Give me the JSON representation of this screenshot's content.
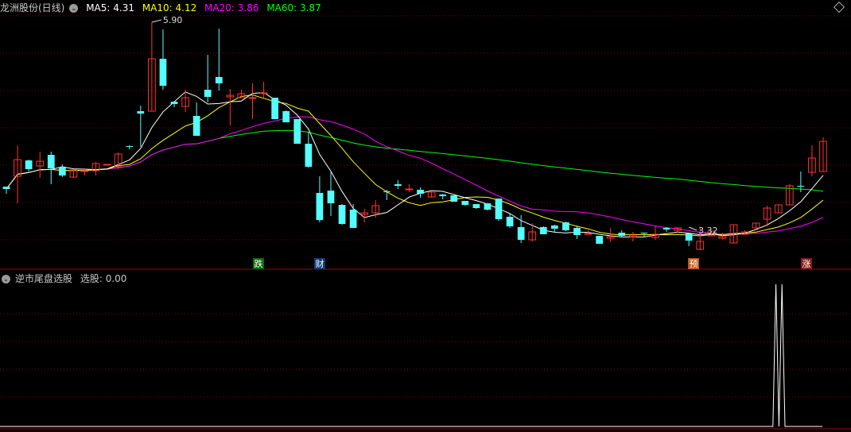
{
  "top_legend": {
    "stock_name": "龙洲股份(日线)",
    "ma5": "MA5: 4.31",
    "ma10": "MA10: 4.12",
    "ma20": "MA20: 3.86",
    "ma60": "MA60: 3.87"
  },
  "bottom_legend": {
    "indicator": "逆市尾盘选股",
    "value": "选股: 0.00"
  },
  "colors": {
    "up": "#ff3232",
    "down": "#54ffff",
    "ma5": "#ffffff",
    "ma10": "#ffff00",
    "ma20": "#ff00ff",
    "ma60": "#00ff00",
    "grid": "#8b0000",
    "signal": "#ffffff"
  },
  "chart_data": [
    {
      "type": "candlestick",
      "ohlc": [
        [
          3.83,
          3.83,
          3.74,
          3.8
        ],
        [
          3.96,
          4.35,
          3.62,
          4.17
        ],
        [
          4.16,
          4.17,
          4.02,
          4.05
        ],
        [
          4.09,
          4.27,
          3.94,
          4.15
        ],
        [
          4.23,
          4.27,
          3.86,
          4.06
        ],
        [
          4.07,
          4.11,
          3.95,
          3.97
        ],
        [
          3.95,
          4.05,
          3.94,
          4.04
        ],
        [
          4.02,
          4.05,
          3.97,
          4.03
        ],
        [
          4.03,
          4.14,
          3.97,
          4.12
        ],
        [
          4.11,
          4.11,
          4.11,
          4.11
        ],
        [
          4.08,
          4.26,
          4.05,
          4.24
        ],
        [
          4.34,
          4.35,
          4.3,
          4.33
        ],
        [
          4.78,
          4.85,
          4.33,
          4.75
        ],
        [
          4.78,
          5.9,
          4.78,
          5.44
        ],
        [
          5.44,
          5.81,
          5.05,
          5.1
        ],
        [
          4.9,
          4.9,
          4.83,
          4.87
        ],
        [
          4.84,
          5.05,
          4.77,
          4.95
        ],
        [
          4.72,
          4.89,
          4.49,
          4.47
        ],
        [
          5.05,
          5.49,
          4.89,
          4.96
        ],
        [
          5.21,
          5.82,
          5.04,
          5.13
        ],
        [
          4.96,
          5.06,
          4.6,
          4.98
        ],
        [
          4.95,
          5.05,
          4.97,
          5.0
        ],
        [
          4.95,
          5.13,
          4.68,
          4.95
        ],
        [
          5.01,
          5.15,
          4.95,
          5.01
        ],
        [
          4.95,
          4.95,
          4.75,
          4.68
        ],
        [
          4.78,
          4.79,
          4.64,
          4.64
        ],
        [
          4.68,
          4.57,
          4.41,
          4.37
        ],
        [
          4.37,
          4.52,
          4.07,
          4.08
        ],
        [
          3.75,
          3.96,
          3.38,
          3.41
        ],
        [
          3.78,
          4.01,
          3.46,
          3.62
        ],
        [
          3.6,
          3.61,
          3.35,
          3.36
        ],
        [
          3.54,
          3.61,
          3.31,
          3.31
        ],
        [
          3.48,
          3.55,
          3.38,
          3.5
        ],
        [
          3.5,
          3.66,
          3.44,
          3.59
        ],
        [
          3.77,
          3.79,
          3.66,
          3.76
        ],
        [
          3.86,
          3.91,
          3.8,
          3.84
        ],
        [
          3.8,
          3.86,
          3.76,
          3.8
        ],
        [
          3.79,
          3.82,
          3.69,
          3.74
        ],
        [
          3.7,
          3.77,
          3.69,
          3.76
        ],
        [
          3.73,
          3.74,
          3.67,
          3.71
        ],
        [
          3.72,
          3.72,
          3.64,
          3.64
        ],
        [
          3.65,
          3.64,
          3.59,
          3.6
        ],
        [
          3.61,
          3.6,
          3.55,
          3.56
        ],
        [
          3.62,
          3.61,
          3.53,
          3.54
        ],
        [
          3.68,
          3.55,
          3.4,
          3.42
        ],
        [
          3.45,
          3.49,
          3.31,
          3.33
        ],
        [
          3.32,
          3.47,
          3.12,
          3.16
        ],
        [
          3.16,
          3.37,
          3.14,
          3.26
        ],
        [
          3.32,
          3.33,
          3.25,
          3.23
        ],
        [
          3.34,
          3.35,
          3.25,
          3.3
        ],
        [
          3.38,
          3.39,
          3.27,
          3.28
        ],
        [
          3.31,
          3.34,
          3.17,
          3.22
        ],
        [
          3.24,
          3.28,
          3.25,
          3.24
        ],
        [
          3.21,
          3.19,
          3.11,
          3.11
        ],
        [
          3.18,
          3.31,
          3.13,
          3.2
        ],
        [
          3.25,
          3.28,
          3.2,
          3.21
        ],
        [
          3.2,
          3.26,
          3.14,
          3.22
        ],
        [
          3.25,
          3.25,
          3.19,
          3.24
        ],
        [
          3.19,
          3.33,
          3.16,
          3.23
        ],
        [
          3.31,
          3.32,
          3.26,
          3.29
        ],
        [
          3.28,
          3.31,
          3.25,
          3.31
        ],
        [
          3.24,
          3.18,
          3.08,
          3.15
        ],
        [
          3.04,
          3.32,
          3.03,
          3.14
        ],
        [
          3.21,
          3.23,
          3.26,
          3.27
        ],
        [
          3.18,
          3.25,
          3.17,
          3.2
        ],
        [
          3.12,
          3.34,
          3.13,
          3.35
        ],
        [
          3.23,
          3.28,
          3.24,
          3.26
        ],
        [
          3.31,
          3.3,
          3.33,
          3.37
        ],
        [
          3.42,
          3.59,
          3.33,
          3.56
        ],
        [
          3.5,
          3.57,
          3.58,
          3.6
        ],
        [
          3.6,
          3.86,
          3.62,
          3.84
        ],
        [
          3.84,
          4.02,
          3.76,
          3.83
        ],
        [
          4.01,
          4.35,
          3.96,
          4.19
        ],
        [
          4.02,
          4.45,
          4.16,
          4.4
        ]
      ]
    },
    {
      "type": "line",
      "series": [
        {
          "name": "选股",
          "values": [
            0,
            0,
            1,
            0,
            1,
            0,
            0,
            0,
            0,
            0,
            0
          ]
        }
      ]
    }
  ],
  "labels": {
    "high": "5.90",
    "low": "3.32",
    "marker_die": "跌",
    "marker_cai": "财",
    "marker_yu": "预",
    "marker_zhang": "涨"
  }
}
